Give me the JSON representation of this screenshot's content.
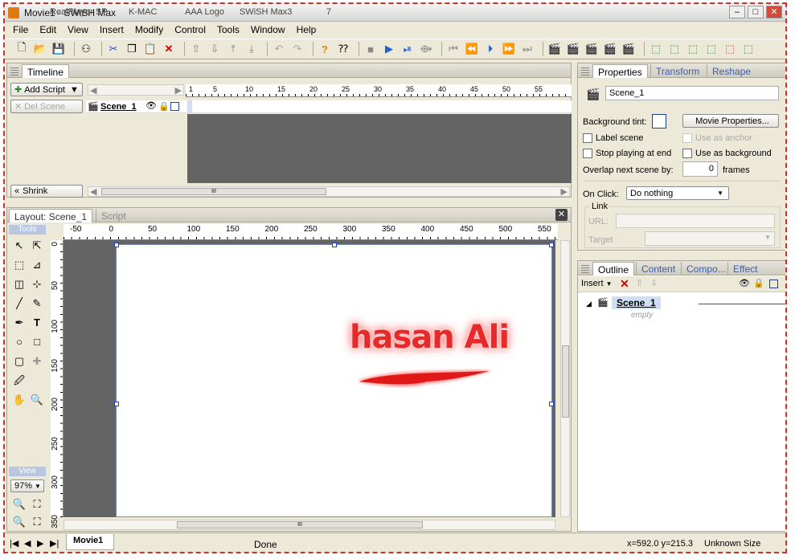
{
  "window": {
    "title": "Movie1 - SWiSH Max",
    "taskbar": [
      "RealPlayer SP",
      "K-MAC",
      "AAA Logo",
      "SWiSH Max3",
      "7"
    ]
  },
  "menu": [
    "File",
    "Edit",
    "View",
    "Insert",
    "Modify",
    "Control",
    "Tools",
    "Window",
    "Help"
  ],
  "timeline": {
    "title": "Timeline",
    "add_script": "Add Script",
    "del_scene": "Del Scene",
    "shrink": "Shrink",
    "scene": "Scene_1",
    "ticks": [
      "1",
      "5",
      "10",
      "15",
      "20",
      "25",
      "30",
      "35",
      "40",
      "45",
      "50",
      "55"
    ]
  },
  "layout": {
    "tab_layout": "Layout: Scene_1",
    "tab_script": "Script",
    "ruler_h": [
      "-50",
      "0",
      "50",
      "100",
      "150",
      "200",
      "250",
      "300",
      "350",
      "400",
      "450",
      "500",
      "550"
    ],
    "ruler_v": [
      "0",
      "50",
      "100",
      "150",
      "200",
      "250",
      "300",
      "350"
    ],
    "tools_label": "Tools",
    "view_label": "View",
    "zoom": "97%"
  },
  "canvas": {
    "text": "hasan Ali",
    "text_color": "#e02020"
  },
  "properties": {
    "tabs": [
      "Properties",
      "Transform",
      "Reshape"
    ],
    "scene_name": "Scene_1",
    "bg_tint": "Background tint:",
    "movie_props": "Movie Properties...",
    "label_scene": "Label scene",
    "use_anchor": "Use as anchor",
    "stop_playing": "Stop playing at end",
    "use_background": "Use as background",
    "overlap": "Overlap next scene by:",
    "overlap_value": "0",
    "frames": "frames",
    "on_click": "On Click:",
    "on_click_value": "Do nothing",
    "link": "Link",
    "url": "URL:",
    "target": "Target"
  },
  "outline": {
    "tabs": [
      "Outline",
      "Content",
      "Compo...",
      "Effect"
    ],
    "insert": "Insert",
    "scene": "Scene_1",
    "empty": "empty"
  },
  "status": {
    "movie_tab": "Movie1",
    "done": "Done",
    "coords": "x=592.0 y=215.3",
    "size": "Unknown Size"
  }
}
